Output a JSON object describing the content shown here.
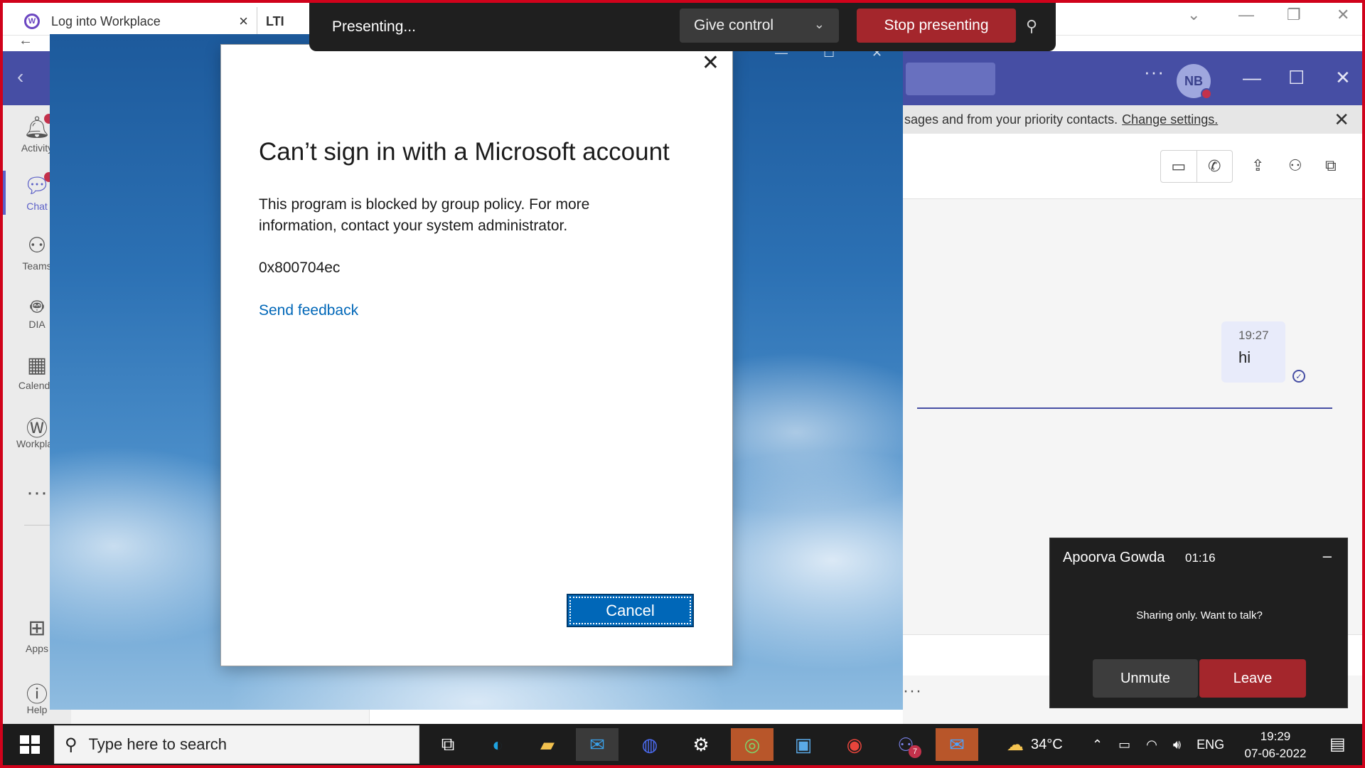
{
  "browser": {
    "tab1_title": "Log into Workplace",
    "tab1_icon": "W",
    "tab2_title": "LTI"
  },
  "teams": {
    "avatar_initials": "NB",
    "banner_text": "sages and from your priority contacts.",
    "banner_link": "Change settings.",
    "rail": [
      {
        "label": "Activity",
        "icon": "bell-icon",
        "badge": ""
      },
      {
        "label": "Chat",
        "icon": "chat-icon",
        "badge": ""
      },
      {
        "label": "Teams",
        "icon": "teams-icon"
      },
      {
        "label": "DIA",
        "icon": "bot-icon"
      },
      {
        "label": "Calenda",
        "icon": "calendar-icon"
      },
      {
        "label": "Workplac",
        "icon": "workplace-icon"
      },
      {
        "label": "Apps",
        "icon": "apps-icon"
      },
      {
        "label": "Help",
        "icon": "help-icon"
      }
    ],
    "message": {
      "time": "19:27",
      "text": "hi"
    }
  },
  "dialog": {
    "title": "Can’t sign in with a Microsoft account",
    "body": "This program is blocked by group policy. For more information, contact your system administrator.",
    "code": "0x800704ec",
    "link": "Send feedback",
    "cancel": "Cancel"
  },
  "presenting": {
    "label": "Presenting...",
    "give_control": "Give control",
    "stop": "Stop presenting"
  },
  "meeting": {
    "name": "Apoorva Gowda",
    "time": "01:16",
    "message": "Sharing only. Want to talk?",
    "unmute": "Unmute",
    "leave": "Leave"
  },
  "taskbar": {
    "search_placeholder": "Type here to search",
    "teams_badge": "7",
    "temperature": "34°C",
    "language": "ENG",
    "time": "19:29",
    "date": "07-06-2022"
  },
  "colors": {
    "present_red": "#d0021b",
    "teams_purple": "#464ea4",
    "dialog_blue": "#0067b8",
    "stop_red": "#a4262c"
  }
}
